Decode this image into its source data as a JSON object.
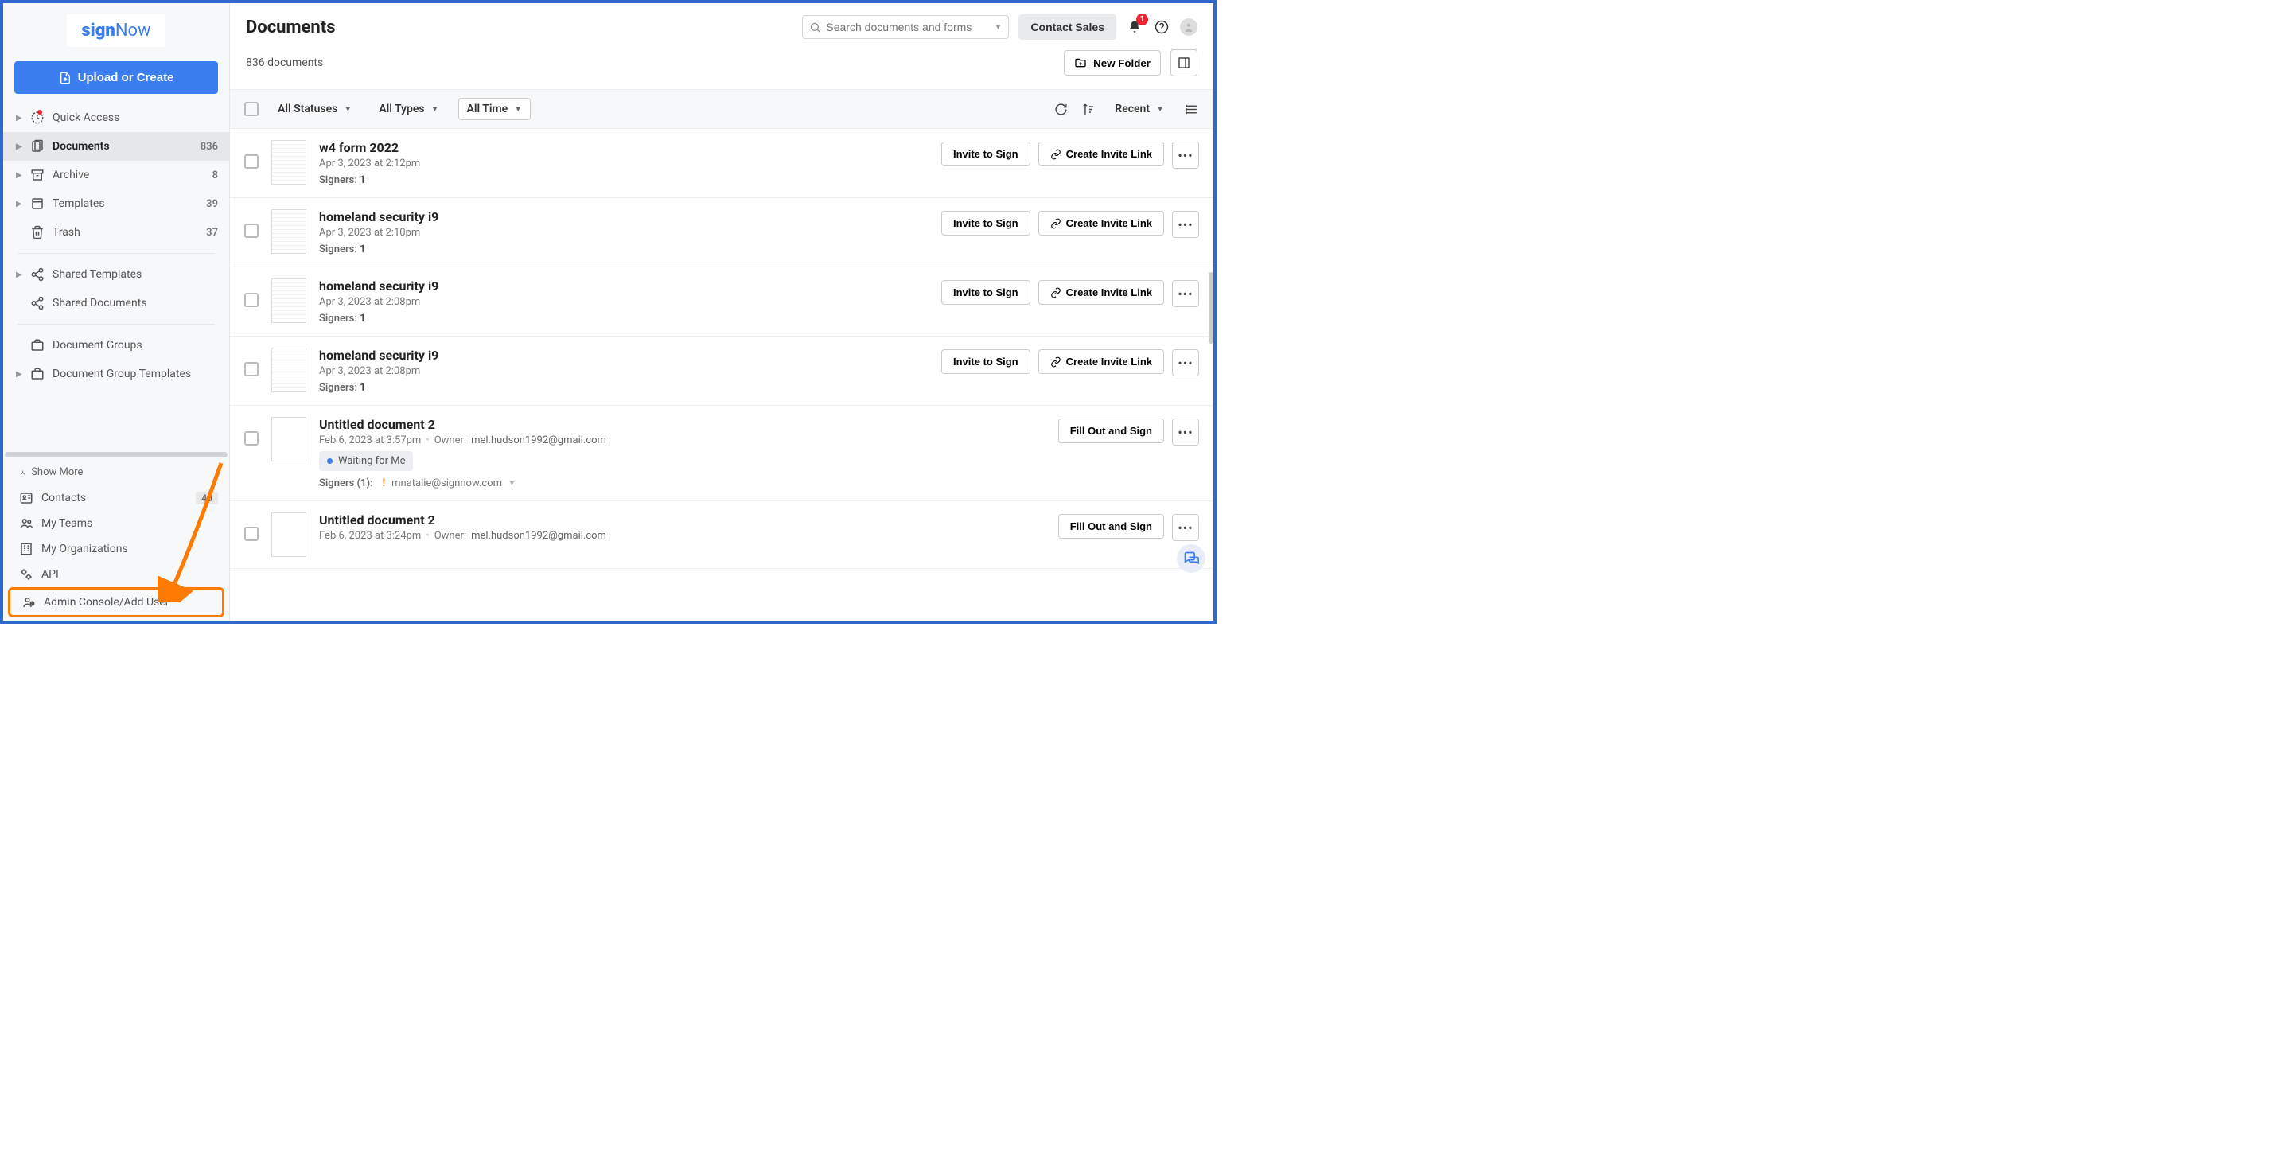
{
  "logo": {
    "brand_sign": "sign",
    "brand_now": "Now"
  },
  "upload_button": "Upload or Create",
  "sidebar": {
    "quick_access": "Quick Access",
    "items": [
      {
        "label": "Documents",
        "count": "836"
      },
      {
        "label": "Archive",
        "count": "8"
      },
      {
        "label": "Templates",
        "count": "39"
      },
      {
        "label": "Trash",
        "count": "37"
      }
    ],
    "shared_templates": "Shared Templates",
    "shared_documents": "Shared Documents",
    "document_groups": "Document Groups",
    "document_group_templates": "Document Group Templates",
    "show_more": "Show More",
    "contacts": {
      "label": "Contacts",
      "count": "40"
    },
    "my_teams": "My Teams",
    "my_organizations": "My Organizations",
    "api": "API",
    "admin_console": "Admin Console/Add User"
  },
  "header": {
    "title": "Documents",
    "search_placeholder": "Search documents and forms",
    "contact_sales": "Contact Sales",
    "notif_count": "1"
  },
  "subheader": {
    "doc_count": "836 documents",
    "new_folder": "New Folder"
  },
  "filters": {
    "statuses": "All Statuses",
    "types": "All Types",
    "time": "All Time",
    "sort": "Recent"
  },
  "actions": {
    "invite_to_sign": "Invite to Sign",
    "create_invite_link": "Create Invite Link",
    "fill_out_sign": "Fill Out and Sign"
  },
  "documents": [
    {
      "title": "w4 form 2022",
      "date": "Apr 3, 2023 at 2:12pm",
      "signers_label": "Signers:",
      "signers": "1",
      "invite": true
    },
    {
      "title": "homeland security i9",
      "date": "Apr 3, 2023 at 2:10pm",
      "signers_label": "Signers:",
      "signers": "1",
      "invite": true
    },
    {
      "title": "homeland security i9",
      "date": "Apr 3, 2023 at 2:08pm",
      "signers_label": "Signers:",
      "signers": "1",
      "invite": true
    },
    {
      "title": "homeland security i9",
      "date": "Apr 3, 2023 at 2:08pm",
      "signers_label": "Signers:",
      "signers": "1",
      "invite": true
    },
    {
      "title": "Untitled document 2",
      "date": "Feb 6, 2023 at 3:57pm",
      "owner_label": "Owner:",
      "owner": "mel.hudson1992@gmail.com",
      "status": "Waiting for Me",
      "signers_count_label": "Signers (1):",
      "signer_email": "mnatalie@signnow.com",
      "fillout": true
    },
    {
      "title": "Untitled document 2",
      "date": "Feb 6, 2023 at 3:24pm",
      "owner_label": "Owner:",
      "owner": "mel.hudson1992@gmail.com",
      "fillout": true
    }
  ]
}
